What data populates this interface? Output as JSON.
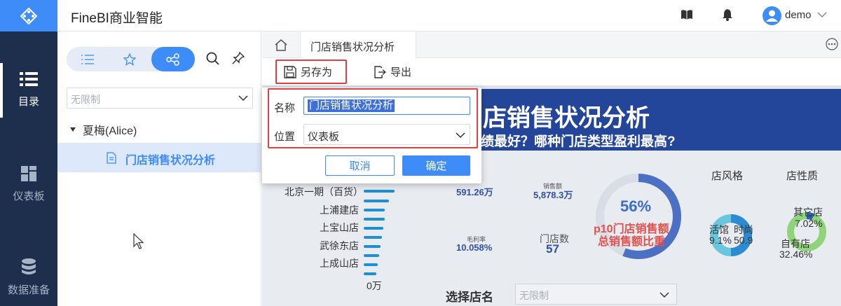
{
  "app": {
    "title": "FineBI商业智能"
  },
  "user": {
    "name": "demo"
  },
  "rail": {
    "items": [
      {
        "label": "目录",
        "icon": "list-icon"
      },
      {
        "label": "仪表板",
        "icon": "dashboard-icon"
      },
      {
        "label": "数据准备",
        "icon": "database-icon"
      }
    ]
  },
  "sidebar": {
    "filter": "无限制",
    "tree": {
      "parent": "夏梅(Alice)",
      "child": "门店销售状况分析"
    }
  },
  "tabs": {
    "active": "门店销售状况分析"
  },
  "toolbar": {
    "save_as": "另存为",
    "export": "导出"
  },
  "dialog": {
    "name_label": "名称",
    "name_value": "门店销售状况分析",
    "location_label": "位置",
    "location_value": "仪表板",
    "cancel": "取消",
    "confirm": "确定"
  },
  "dashboard": {
    "title": "店销售状况分析",
    "subtitle": "绩最好？哪种门店类型盈利最高?",
    "bars": {
      "labels": [
        "北京一期（百货）",
        "上浦建店",
        "上宝山店",
        "武徐东店",
        "上成山店"
      ],
      "zero_label": "0万"
    },
    "kpis": {
      "value_a": "591.26万",
      "sales_label": "销售额",
      "sales_value": "5,878.3万",
      "margin_label": "毛利率",
      "margin_value": "10.058%",
      "store_count_label": "门店数",
      "store_count_value": "57"
    },
    "donut": {
      "percent": "56%",
      "percent_value": 56,
      "line1": "p10门店销售额",
      "line2": "总销售额比重"
    },
    "store_style": {
      "title": "店风格",
      "left_label": "活馆",
      "right_label": "时尚",
      "left_pct": "9.1%",
      "right_pct": "50.9"
    },
    "store_type": {
      "title": "店性质",
      "other_label": "其它店",
      "other_pct": "7.02%",
      "own_label": "自有店",
      "own_pct": "32.46%"
    },
    "choose": {
      "label": "选择店名",
      "placeholder": "无限制"
    }
  }
}
